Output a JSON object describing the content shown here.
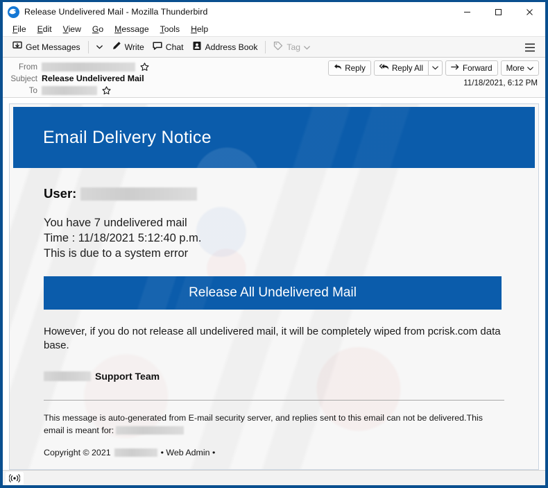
{
  "window": {
    "title": "Release Undelivered Mail - Mozilla Thunderbird",
    "app_icon": "thunderbird-icon",
    "controls": {
      "minimize": "–",
      "maximize": "☐",
      "close": "✕"
    }
  },
  "menubar": {
    "items": [
      {
        "label": "File",
        "accel": "F"
      },
      {
        "label": "Edit",
        "accel": "E"
      },
      {
        "label": "View",
        "accel": "V"
      },
      {
        "label": "Go",
        "accel": "G"
      },
      {
        "label": "Message",
        "accel": "M"
      },
      {
        "label": "Tools",
        "accel": "T"
      },
      {
        "label": "Help",
        "accel": "H"
      }
    ]
  },
  "toolbar": {
    "get_messages": "Get Messages",
    "write": "Write",
    "chat": "Chat",
    "address_book": "Address Book",
    "tag": "Tag",
    "tag_disabled": true,
    "hamburger": "app-menu-icon"
  },
  "message_header": {
    "from_label": "From",
    "from_value_redacted": true,
    "subject_label": "Subject",
    "subject_value": "Release Undelivered Mail",
    "to_label": "To",
    "to_value_redacted": true,
    "date": "11/18/2021, 6:12 PM",
    "actions": {
      "reply": "Reply",
      "reply_all": "Reply All",
      "forward": "Forward",
      "more": "More"
    }
  },
  "email": {
    "banner_title": "Email Delivery Notice",
    "user_label": "User:",
    "user_value_redacted": true,
    "lines": [
      "You have 7 undelivered mail",
      "Time : 11/18/2021 5:12:40 p.m.",
      "This is due to a system error"
    ],
    "cta_label": "Release All Undelivered Mail",
    "warning": "However, if you do not release all undelivered mail, it will be completely wiped from pcrisk.com data base.",
    "signature_suffix": "Support Team",
    "footer_disclaimer_part1": "This message is auto-generated from E-mail security server, and replies sent to this email can not be delivered.This email is meant for:",
    "copyright_prefix": "Copyright © 2021",
    "copyright_suffix": "• Web Admin •"
  },
  "statusbar": {
    "icon": "broadcast-icon"
  },
  "colors": {
    "brand_blue": "#0b5cab",
    "window_border": "#0a4f8f",
    "banner_text": "#ffffff"
  }
}
